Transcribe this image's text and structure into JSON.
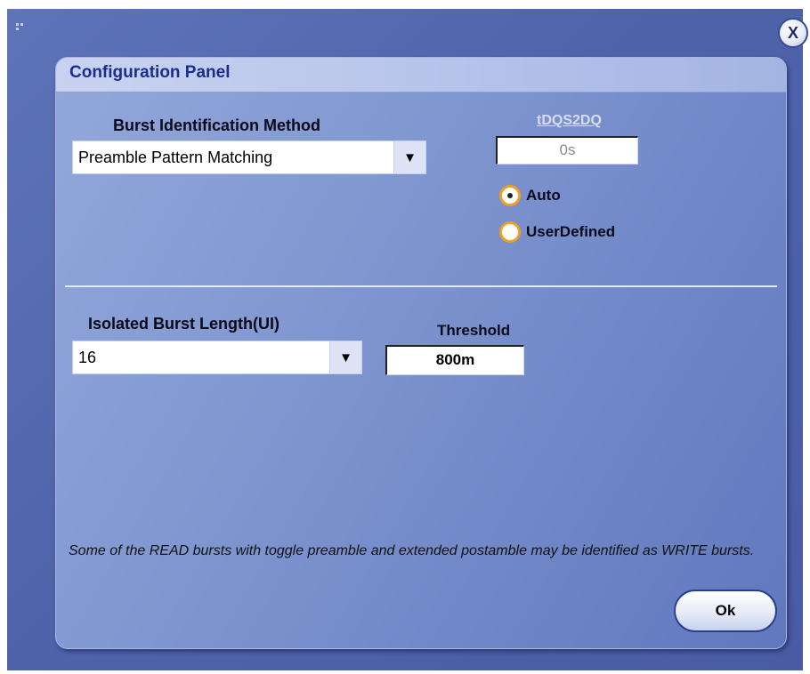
{
  "window": {
    "close_label": "X"
  },
  "panel": {
    "title": "Configuration Panel"
  },
  "burst": {
    "label": "Burst Identification Method",
    "selected": "Preamble Pattern Matching",
    "dropdown_arrow": "▼"
  },
  "tdqs2dq": {
    "label": "tDQS2DQ",
    "value": "0s",
    "options": [
      {
        "label": "Auto",
        "selected": true
      },
      {
        "label": "UserDefined",
        "selected": false
      }
    ]
  },
  "isolated": {
    "label": "Isolated Burst Length(UI)",
    "selected": "16",
    "dropdown_arrow": "▼"
  },
  "threshold": {
    "label": "Threshold",
    "value": "800m"
  },
  "note": "Some of the READ bursts with toggle preamble and extended postamble may be identified as WRITE bursts.",
  "ok_label": "Ok",
  "colors": {
    "radio_ring": "#f0a020",
    "title_text": "#1b2d8f",
    "window_bg": "#4f63ab"
  },
  "icons": {
    "close": "close-icon",
    "dropdown": "chevron-down-icon",
    "grip": "grip-icon"
  }
}
